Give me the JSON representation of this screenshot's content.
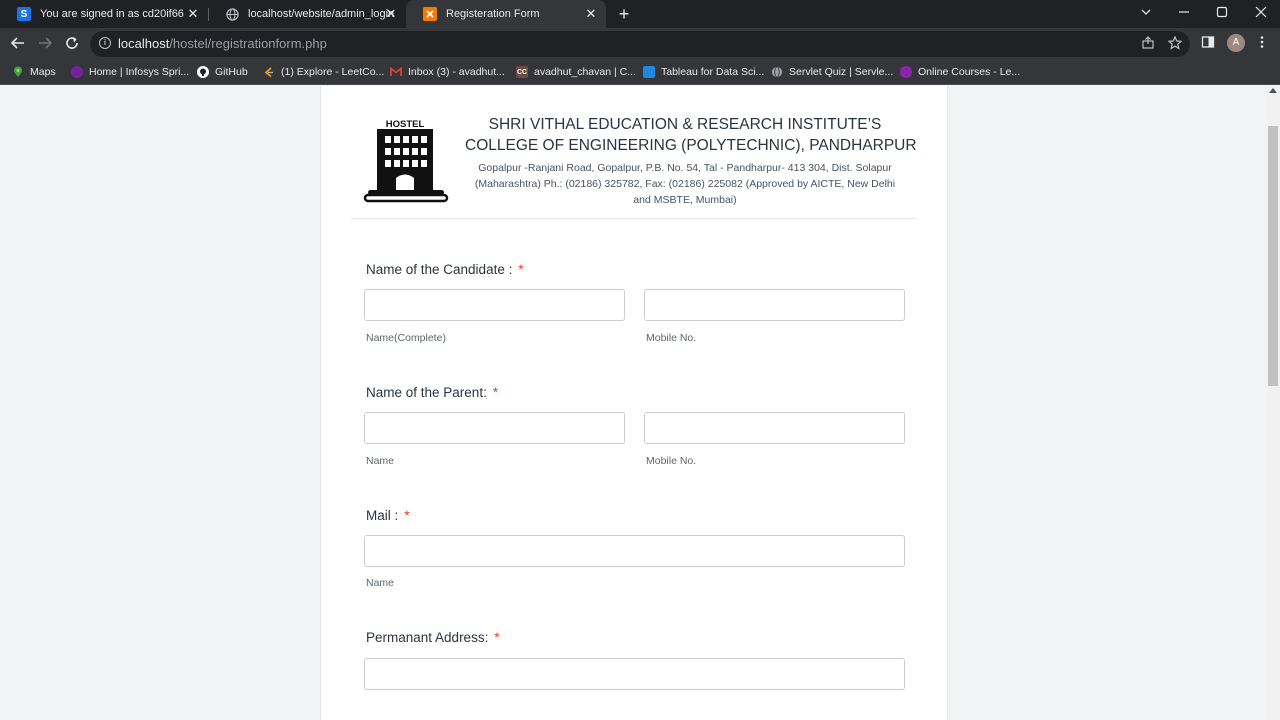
{
  "browser": {
    "tabs": [
      {
        "title": "You are signed in as cd20if66",
        "favicon_letter": "S",
        "favicon_color": "#1a73e8"
      },
      {
        "title": "localhost/website/admin_login.php",
        "favicon_letter": "",
        "favicon_color": "#9aa0a6"
      },
      {
        "title": "Registeration Form",
        "favicon_letter": "",
        "favicon_color": "#f57c00"
      }
    ],
    "url_host": "localhost",
    "url_path": "/hostel/registrationform.php",
    "profile_initial": "A",
    "bookmarks": [
      {
        "label": "Maps",
        "color": "#34a853"
      },
      {
        "label": "Home | Infosys Spri...",
        "color": "#7b1fa2"
      },
      {
        "label": "GitHub",
        "color": "#ffffff"
      },
      {
        "label": "(1) Explore - LeetCo...",
        "color": "#ffa116"
      },
      {
        "label": "Inbox (3) - avadhut...",
        "color": "#ea4335"
      },
      {
        "label": "avadhut_chavan | C...",
        "color": "#6d4c41"
      },
      {
        "label": "Tableau for Data Sci...",
        "color": "#1e88e5"
      },
      {
        "label": "Servlet Quiz | Servle...",
        "color": "#9aa0a6"
      },
      {
        "label": "Online Courses - Le...",
        "color": "#8e24aa"
      }
    ]
  },
  "header": {
    "logo_text": "HOSTEL",
    "institute_line1": "SHRI VITHAL EDUCATION & RESEARCH INSTITUTE’S",
    "institute_line2": "COLLEGE OF ENGINEERING (POLYTECHNIC), PANDHARPUR",
    "address_line1": "Gopalpur -Ranjani Road, Gopalpur, P.B. No. 54, Tal - Pandharpur- 413 304, Dist. Solapur",
    "address_line2": "(Maharashtra) Ph.: (02186) 325782, Fax: (02186) 225082 (Approved by AICTE, New Delhi",
    "address_line3": "and MSBTE, Mumbai)"
  },
  "form": {
    "required_mark": "*",
    "candidate": {
      "label": "Name of the Candidate :",
      "sub_left": "Name(Complete)",
      "sub_right": "Mobile No."
    },
    "parent": {
      "label": "Name of the Parent:",
      "sub_left": "Name",
      "sub_right": "Mobile No."
    },
    "mail": {
      "label": "Mail :",
      "sub": "Name"
    },
    "address": {
      "label": "Permanant Address:"
    }
  }
}
